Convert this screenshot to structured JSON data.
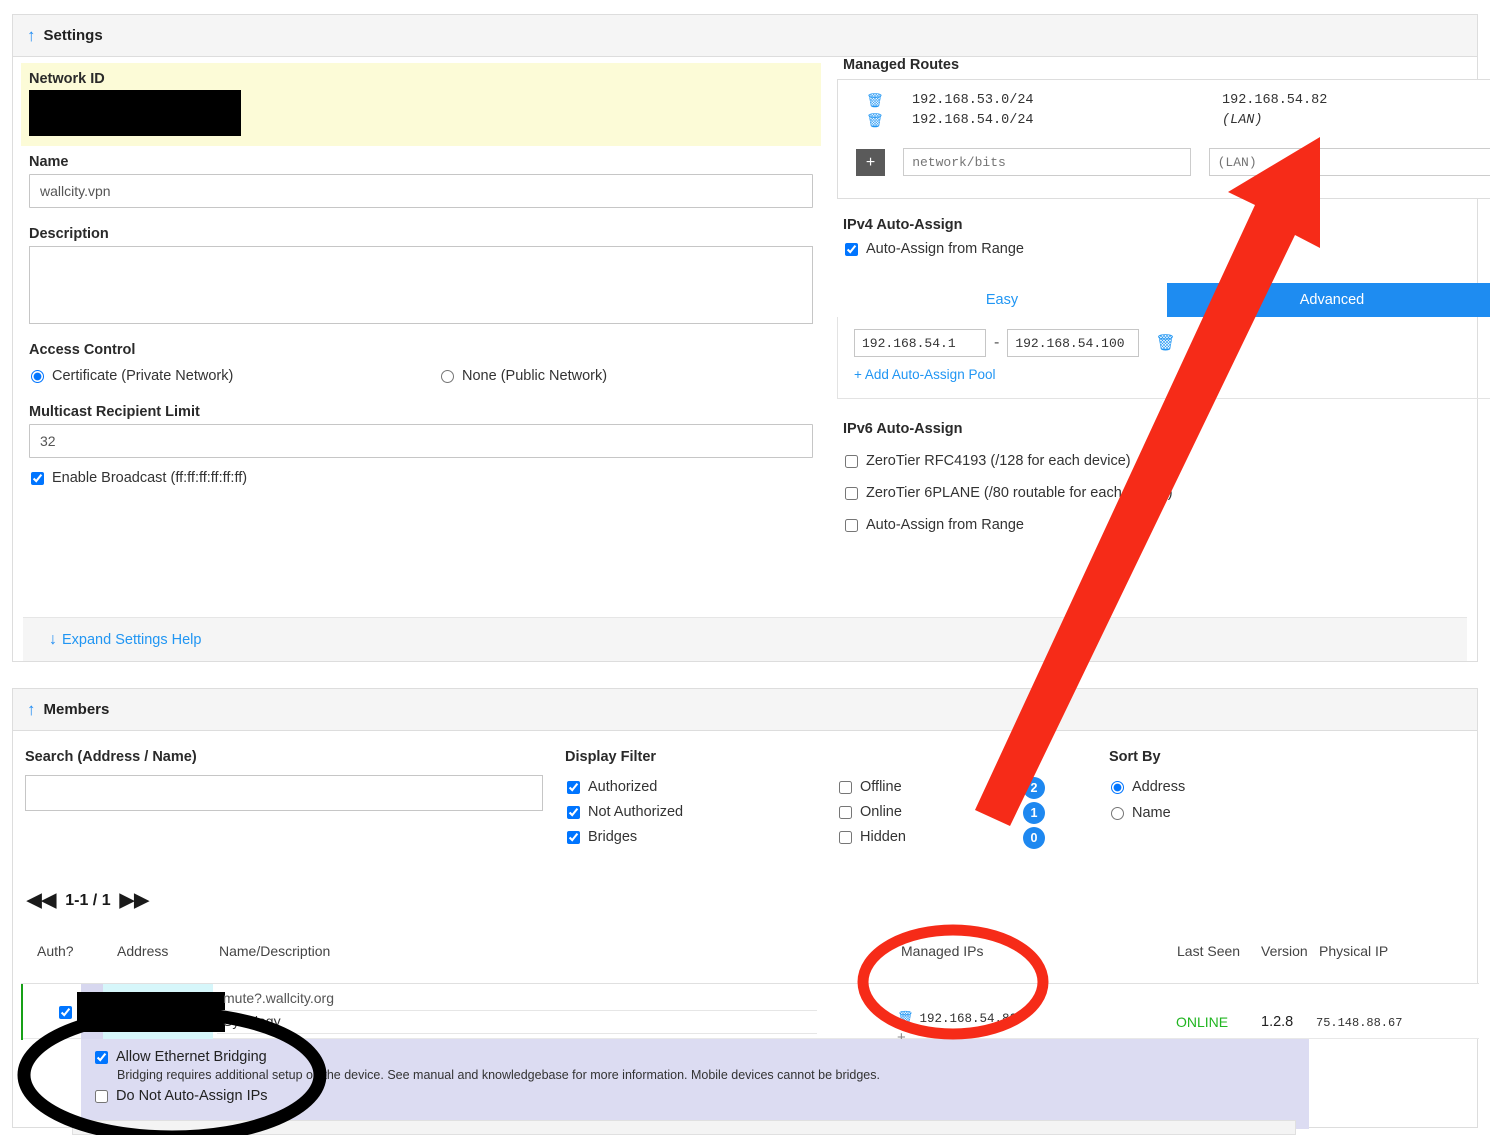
{
  "settings": {
    "section_title": "Settings",
    "network_id_label": "Network ID",
    "network_id_value": "",
    "name_label": "Name",
    "name_value": "wallcity.vpn",
    "description_label": "Description",
    "description_value": "",
    "access_control_label": "Access Control",
    "access_options": [
      {
        "label": "Certificate (Private Network)",
        "selected": true
      },
      {
        "label": "None (Public Network)",
        "selected": false
      }
    ],
    "multicast_label": "Multicast Recipient Limit",
    "multicast_value": "32",
    "broadcast_label": "Enable Broadcast (ff:ff:ff:ff:ff:ff)",
    "broadcast_checked": true,
    "expand_help_label": "Expand Settings Help"
  },
  "managed_routes": {
    "title": "Managed Routes",
    "rows": [
      {
        "target": "192.168.53.0/24",
        "via": "192.168.54.82",
        "via_italic": false
      },
      {
        "target": "192.168.54.0/24",
        "via": "(LAN)",
        "via_italic": true
      }
    ],
    "add_button_label": "+",
    "network_placeholder": "network/bits",
    "via_placeholder": "(LAN)"
  },
  "ipv4": {
    "title": "IPv4 Auto-Assign",
    "auto_assign_label": "Auto-Assign from Range",
    "auto_assign_checked": true,
    "tabs": [
      {
        "label": "Easy",
        "active": false
      },
      {
        "label": "Advanced",
        "active": true
      }
    ],
    "pool_start": "192.168.54.1",
    "pool_separator": "-",
    "pool_end": "192.168.54.100",
    "add_pool_label": "+ Add Auto-Assign Pool"
  },
  "ipv6": {
    "title": "IPv6 Auto-Assign",
    "options": [
      {
        "label": "ZeroTier RFC4193 (/128 for each device)",
        "checked": false
      },
      {
        "label": "ZeroTier 6PLANE (/80 routable for each device)",
        "checked": false
      },
      {
        "label": "Auto-Assign from Range",
        "checked": false
      }
    ]
  },
  "members": {
    "section_title": "Members",
    "search_label": "Search (Address / Name)",
    "search_value": "",
    "display_filter_label": "Display Filter",
    "filters_left": [
      {
        "label": "Authorized",
        "checked": true
      },
      {
        "label": "Not Authorized",
        "checked": true
      },
      {
        "label": "Bridges",
        "checked": true
      }
    ],
    "filters_right": [
      {
        "label": "Offline",
        "checked": false,
        "count": "2"
      },
      {
        "label": "Online",
        "checked": false,
        "count": "1"
      },
      {
        "label": "Hidden",
        "checked": false,
        "count": "0"
      }
    ],
    "sort_by_label": "Sort By",
    "sort_options": [
      {
        "label": "Address",
        "selected": true
      },
      {
        "label": "Name",
        "selected": false
      }
    ],
    "pager_first": "◀◀",
    "pager_text": "1-1 / 1",
    "pager_last": "▶▶",
    "columns": {
      "auth": "Auth?",
      "address": "Address",
      "name_description": "Name/Description",
      "managed_ips": "Managed IPs",
      "last_seen": "Last Seen",
      "version": "Version",
      "physical_ip": "Physical IP"
    },
    "row": {
      "authorized": true,
      "address": "",
      "name": "mute?.wallcity.org",
      "description": "Synology",
      "managed_ip": "192.168.54.82",
      "add_ip_glyph": "+",
      "last_seen": "ONLINE",
      "version": "1.2.8",
      "physical_ip": "75.148.88.67"
    },
    "expanded": {
      "bridging_label": "Allow Ethernet Bridging",
      "bridging_checked": true,
      "bridging_note": "Bridging requires additional setup on the device. See manual and knowledgebase for more information. Mobile devices cannot be bridges.",
      "no_auto_assign_label": "Do Not Auto-Assign IPs",
      "no_auto_assign_checked": false
    }
  },
  "icons": {
    "collapse_up": "↑",
    "expand_down": "↓",
    "trash": "Ὕ1",
    "plus": "+"
  },
  "colors": {
    "accent_blue": "#1e88f0",
    "link_blue": "#2196f3",
    "online_green": "#21b521",
    "highlight_yellow": "#fcfbd7",
    "annotation_red": "#f62b18",
    "annotation_black": "#000000",
    "expand_lavender": "#dcdcf2"
  }
}
